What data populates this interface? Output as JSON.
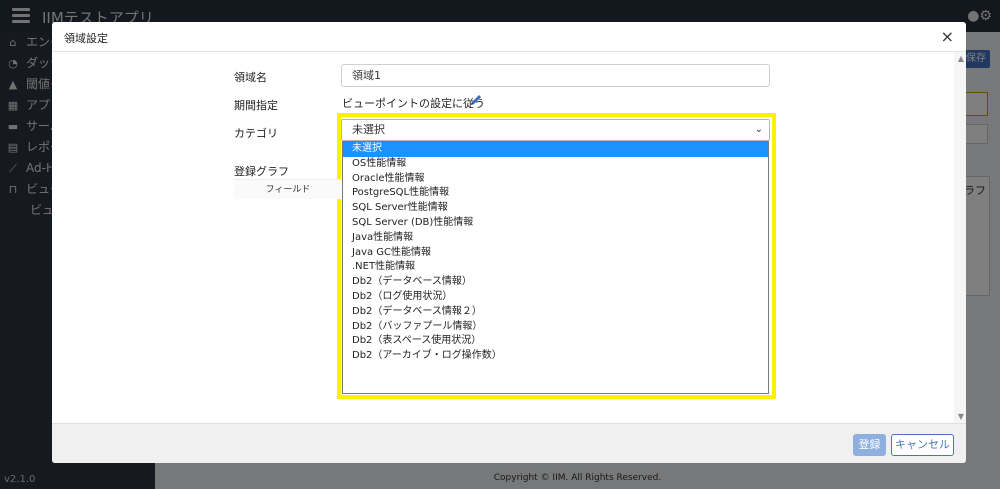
{
  "app": {
    "title": "IIMテストアプリ",
    "version": "v2.1.0",
    "footer": "Copyright © IIM. All Rights Reserved.",
    "save_label": "保存",
    "graph_fragment": "ラフ",
    "sidebar": [
      {
        "label": "エンタープライズ",
        "icon": "home-icon",
        "glyph": "⌂"
      },
      {
        "label": "ダッシュボード",
        "icon": "dashboard-icon",
        "glyph": "◔"
      },
      {
        "label": "閾値モニタ",
        "icon": "warning-icon",
        "glyph": "▲"
      },
      {
        "label": "アプリケーション",
        "icon": "grid-icon",
        "glyph": "▦"
      },
      {
        "label": "サーバー",
        "icon": "server-icon",
        "glyph": "▬"
      },
      {
        "label": "レポート",
        "icon": "report-icon",
        "glyph": "▤"
      },
      {
        "label": "Ad-Hoc",
        "icon": "chart-icon",
        "glyph": "⟋"
      },
      {
        "label": "ビュー",
        "icon": "binoculars-icon",
        "glyph": "⊓"
      }
    ],
    "sidebar_sub": "ビュー"
  },
  "modal": {
    "title": "領域設定",
    "close": "×",
    "labels": {
      "region_name": "領域名",
      "period": "期間指定",
      "category": "カテゴリ",
      "graph": "登録グラフ"
    },
    "region_name_value": "領域1",
    "period_text": "ビューポイントの設定に従う",
    "category_selected": "未選択",
    "category_options": [
      "未選択",
      "OS性能情報",
      "Oracle性能情報",
      "PostgreSQL性能情報",
      "SQL Server性能情報",
      "SQL Server (DB)性能情報",
      "Java性能情報",
      "Java GC性能情報",
      ".NET性能情報",
      "Db2（データベース情報）",
      "Db2（ログ使用状況）",
      "Db2（データベース情報２）",
      "Db2（バッファプール情報）",
      "Db2（表スペース使用状況）",
      "Db2（アーカイブ・ログ操作数）"
    ],
    "field_header": "フィールド",
    "buttons": {
      "register": "登録",
      "cancel": "キャンセル"
    }
  },
  "colors": {
    "highlight": "#ffef00",
    "selected_option": "#1e90ff",
    "primary": "#4a76b8"
  }
}
